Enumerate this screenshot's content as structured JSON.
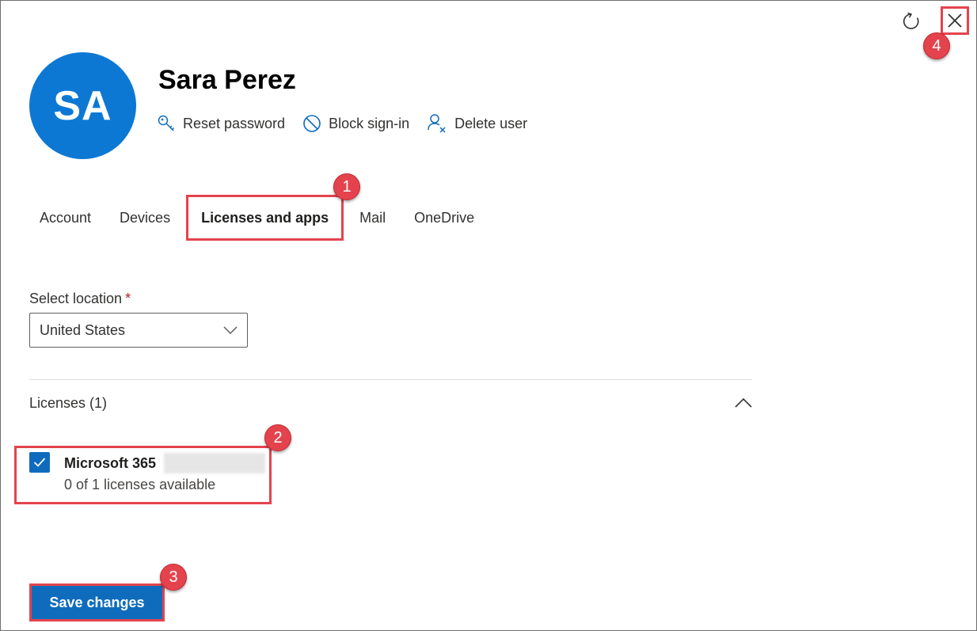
{
  "user": {
    "initials": "SA",
    "name": "Sara Perez",
    "avatar_color": "#0d78d4"
  },
  "header_actions": [
    {
      "label": "Reset password",
      "icon": "key-icon"
    },
    {
      "label": "Block sign-in",
      "icon": "block-icon"
    },
    {
      "label": "Delete user",
      "icon": "delete-user-icon"
    }
  ],
  "tabs": [
    {
      "label": "Account",
      "active": false
    },
    {
      "label": "Devices",
      "active": false
    },
    {
      "label": "Licenses and apps",
      "active": true
    },
    {
      "label": "Mail",
      "active": false
    },
    {
      "label": "OneDrive",
      "active": false
    }
  ],
  "location": {
    "label": "Select location",
    "required_mark": "*",
    "value": "United States"
  },
  "licenses": {
    "header": "Licenses (1)",
    "expanded": true,
    "items": [
      {
        "name": "Microsoft 365",
        "availability": "0 of 1 licenses available",
        "checked": true
      }
    ]
  },
  "footer": {
    "save_label": "Save changes"
  },
  "annotations": {
    "tab_step": "1",
    "license_step": "2",
    "save_step": "3",
    "close_step": "4"
  },
  "colors": {
    "accent": "#0f6cbd",
    "highlight": "#e4434d"
  }
}
